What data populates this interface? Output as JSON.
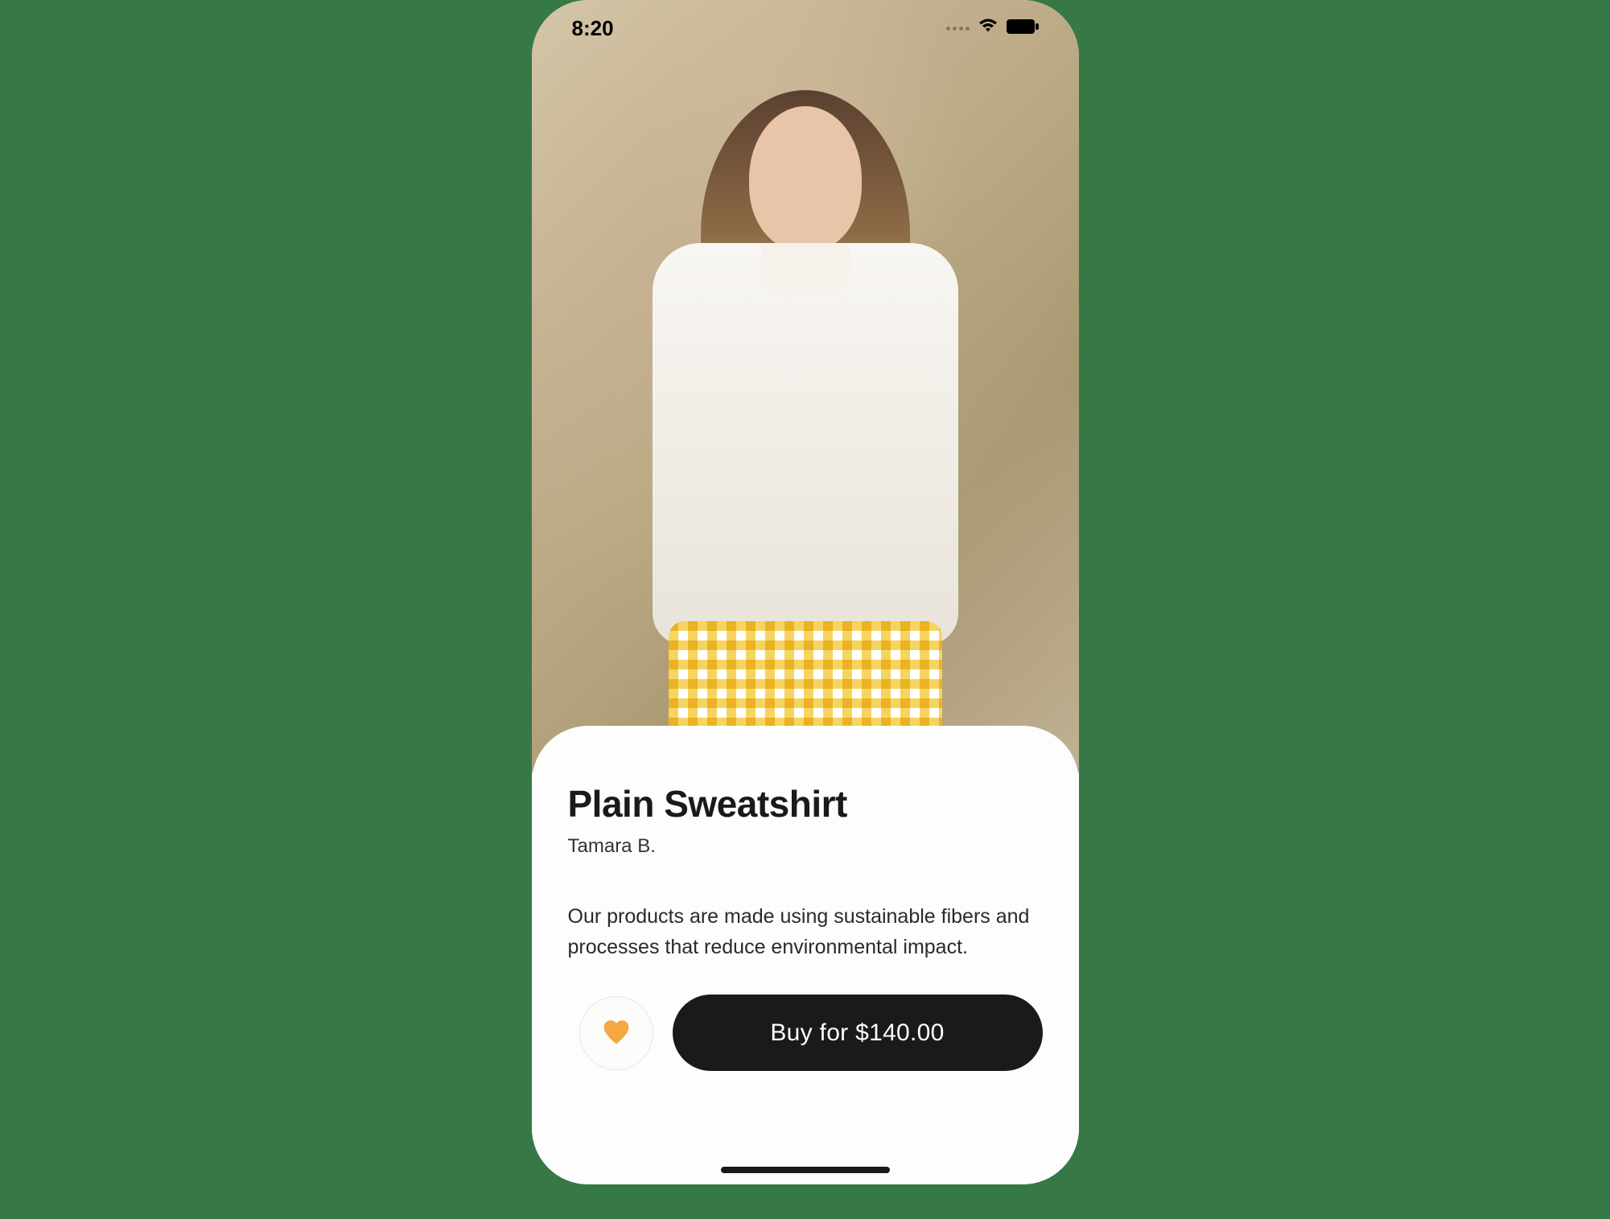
{
  "status_bar": {
    "time": "8:20"
  },
  "product": {
    "title": "Plain Sweatshirt",
    "author": "Tamara B.",
    "description": "Our products are made using sustainable fibers and processes that reduce environmental impact.",
    "buy_label": "Buy for $140.00"
  },
  "colors": {
    "accent": "#f5a623",
    "button_bg": "#1a1a1a"
  }
}
